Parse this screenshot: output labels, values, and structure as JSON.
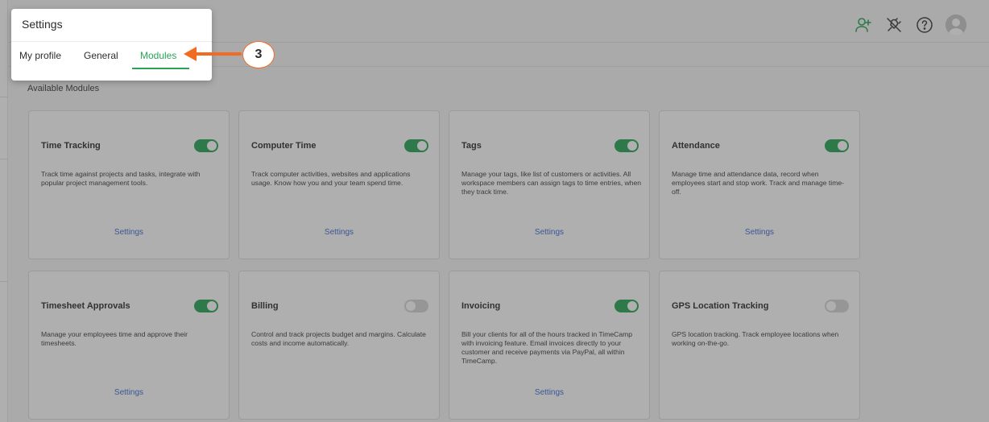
{
  "header": {
    "icons": [
      "add-user-icon",
      "plug-disconnect-icon",
      "help-icon",
      "avatar"
    ],
    "accent_color": "#27a555"
  },
  "settings_popup": {
    "title": "Settings",
    "tabs": [
      {
        "label": "My profile",
        "active": false
      },
      {
        "label": "General",
        "active": false
      },
      {
        "label": "Modules",
        "active": true
      }
    ]
  },
  "annotation": {
    "step": "3",
    "color": "#f26b21"
  },
  "modules": {
    "section_title": "Available Modules",
    "items": [
      {
        "title": "Time Tracking",
        "enabled": true,
        "description": "Track time against projects and tasks, integrate with popular project management tools.",
        "settings_label": "Settings"
      },
      {
        "title": "Computer Time",
        "enabled": true,
        "description": "Track computer activities, websites and applications usage. Know how you and your team spend time.",
        "settings_label": "Settings"
      },
      {
        "title": "Tags",
        "enabled": true,
        "description": "Manage your tags, like list of customers or activities. All workspace members can assign tags to time entries, when they track time.",
        "settings_label": "Settings"
      },
      {
        "title": "Attendance",
        "enabled": true,
        "description": "Manage time and attendance data, record when employees start and stop work. Track and manage time-off.",
        "settings_label": "Settings"
      },
      {
        "title": "Timesheet Approvals",
        "enabled": true,
        "description": "Manage your employees time and approve their timesheets.",
        "settings_label": "Settings"
      },
      {
        "title": "Billing",
        "enabled": false,
        "description": "Control and track projects budget and margins. Calculate costs and income automatically.",
        "settings_label": ""
      },
      {
        "title": "Invoicing",
        "enabled": true,
        "description": "Bill your clients for all of the hours tracked in TimeCamp with invoicing feature. Email invoices directly to your customer and receive payments via PayPal, all within TimeCamp.",
        "settings_label": "Settings"
      },
      {
        "title": "GPS Location Tracking",
        "enabled": false,
        "description": "GPS location tracking. Track employee locations when working on-the-go.",
        "settings_label": ""
      }
    ]
  }
}
